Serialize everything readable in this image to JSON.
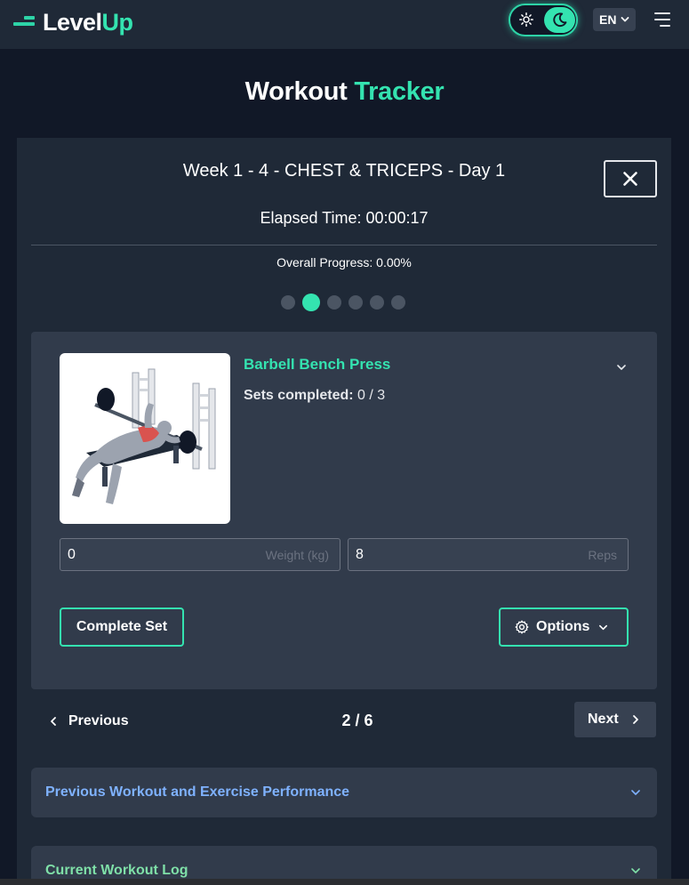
{
  "header": {
    "logo_prefix": "Level",
    "logo_accent": "Up",
    "language": "EN",
    "icons": [
      "sun-icon",
      "moon-icon",
      "chevron-down-icon",
      "hamburger-menu-icon"
    ]
  },
  "page": {
    "title_prefix": "Workout",
    "title_accent": "Tracker"
  },
  "session": {
    "title": "Week 1 - 4 - CHEST & TRICEPS - Day 1",
    "elapsed_time": "Elapsed Time: 00:00:17",
    "overall_progress": "Overall Progress: 0.00%",
    "exercise_dots_total": 6,
    "exercise_dots_active_index": 1
  },
  "exercise": {
    "name": "Barbell Bench Press",
    "sets_label": "Sets completed:",
    "sets_value": "0 / 3",
    "weight_value": "0",
    "weight_placeholder": "Weight (kg)",
    "reps_value": "8",
    "reps_placeholder": "Reps",
    "complete_set_label": "Complete Set",
    "options_label": "Options"
  },
  "navigation": {
    "previous_label": "Previous",
    "pager": "2 / 6",
    "next_label": "Next"
  },
  "sections": {
    "previous_performance": "Previous Workout and Exercise Performance",
    "current_log": "Current Workout Log"
  },
  "colors": {
    "accent": "#34e3b0",
    "previous_section_text": "#7fb2ff",
    "current_section_text": "#7fe0a8",
    "background": "#111827",
    "panel": "#1f2937",
    "card": "#313b4b"
  }
}
